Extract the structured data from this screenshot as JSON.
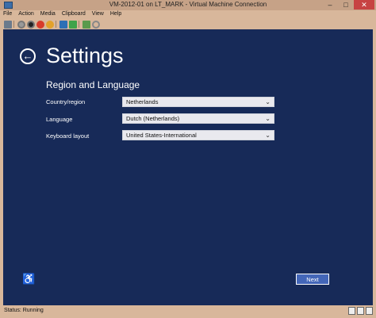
{
  "window": {
    "title": "VM-2012-01 on LT_MARK - Virtual Machine Connection",
    "buttons": {
      "minimize": "–",
      "maximize": "□",
      "close": "✕"
    }
  },
  "menu": [
    "File",
    "Action",
    "Media",
    "Clipboard",
    "View",
    "Help"
  ],
  "toolbar": {
    "icons": [
      "ctrl-alt-del-icon",
      "start-icon",
      "turn-off-icon",
      "shutdown-icon",
      "save-icon",
      "pause-icon",
      "reset-icon",
      "checkpoint-icon",
      "revert-icon"
    ]
  },
  "vm_screen": {
    "title": "Settings",
    "section": "Region and Language",
    "fields": [
      {
        "label": "Country/region",
        "value": "Netherlands"
      },
      {
        "label": "Language",
        "value": "Dutch (Netherlands)"
      },
      {
        "label": "Keyboard layout",
        "value": "United States-International"
      }
    ],
    "next_label": "Next",
    "colors": {
      "background": "#172a58",
      "accent": "#4366b8"
    }
  },
  "statusbar": {
    "status": "Status: Running"
  }
}
